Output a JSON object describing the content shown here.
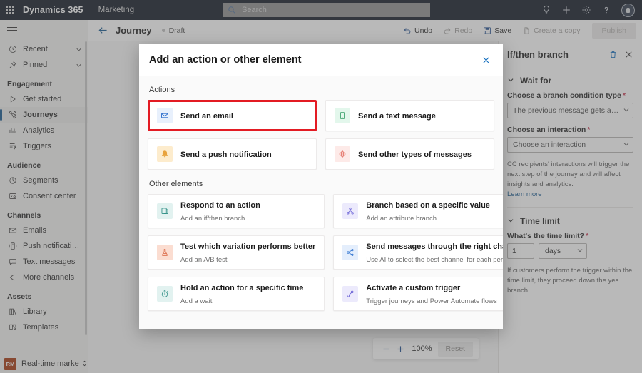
{
  "header": {
    "brand": "Dynamics 365",
    "app_name": "Marketing",
    "waffle_name": "app-launcher",
    "search": {
      "placeholder": "Search",
      "value": ""
    },
    "actions": [
      {
        "name": "lightbulb-icon",
        "label": "Tips"
      },
      {
        "name": "plus-icon",
        "label": "Quick create"
      },
      {
        "name": "gear-icon",
        "label": "Settings"
      },
      {
        "name": "question-icon",
        "label": "Help"
      }
    ],
    "avatar_label": "Account manager"
  },
  "sidebar": {
    "hamburger_label": "Show more",
    "quick": [
      {
        "label": "Recent",
        "icon": "clock-icon",
        "expandable": true
      },
      {
        "label": "Pinned",
        "icon": "pin-icon",
        "expandable": true
      }
    ],
    "groups": [
      {
        "title": "Engagement",
        "items": [
          {
            "label": "Get started",
            "icon": "play-icon",
            "selected": false
          },
          {
            "label": "Journeys",
            "icon": "journeys-icon",
            "selected": true
          },
          {
            "label": "Analytics",
            "icon": "analytics-icon",
            "selected": false
          },
          {
            "label": "Triggers",
            "icon": "triggers-icon",
            "selected": false
          }
        ]
      },
      {
        "title": "Audience",
        "items": [
          {
            "label": "Segments",
            "icon": "segments-icon",
            "selected": false
          },
          {
            "label": "Consent center",
            "icon": "consent-icon",
            "selected": false
          }
        ]
      },
      {
        "title": "Channels",
        "items": [
          {
            "label": "Emails",
            "icon": "email-icon",
            "selected": false
          },
          {
            "label": "Push notifications",
            "icon": "push-icon",
            "selected": false
          },
          {
            "label": "Text messages",
            "icon": "chat-icon",
            "selected": false
          },
          {
            "label": "More channels",
            "icon": "channels-icon",
            "selected": false
          }
        ]
      },
      {
        "title": "Assets",
        "items": [
          {
            "label": "Library",
            "icon": "library-icon",
            "selected": false
          },
          {
            "label": "Templates",
            "icon": "templates-icon",
            "selected": false
          }
        ]
      }
    ],
    "area_switcher": {
      "initials": "RM",
      "label": "Real-time marketi..."
    }
  },
  "commandbar": {
    "back_label": "Back",
    "title": "Journey",
    "status": "Draft",
    "buttons": [
      {
        "label": "Undo",
        "icon": "undo-icon",
        "disabled": false
      },
      {
        "label": "Redo",
        "icon": "redo-icon",
        "disabled": true
      },
      {
        "label": "Save",
        "icon": "save-icon",
        "disabled": false
      },
      {
        "label": "Create a copy",
        "icon": "copy-icon",
        "disabled": true
      }
    ],
    "publish_label": "Publish"
  },
  "dialog": {
    "title": "Add an action or other element",
    "close_label": "Close",
    "sections": [
      {
        "heading": "Actions",
        "cards": [
          {
            "title": "Send an email",
            "subtitle": "",
            "icon": "email-icon",
            "tile_bg": "#e8f0fc",
            "icon_color": "#2266c9",
            "highlighted": true
          },
          {
            "title": "Send a text message",
            "subtitle": "",
            "icon": "phone-icon",
            "tile_bg": "#e3f7ec",
            "icon_color": "#3aa06a",
            "highlighted": false
          },
          {
            "title": "Send a push notification",
            "subtitle": "",
            "icon": "bell-icon",
            "tile_bg": "#fdeccd",
            "icon_color": "#e8a33d",
            "highlighted": false
          },
          {
            "title": "Send other types of messages",
            "subtitle": "",
            "icon": "diamond-icon",
            "tile_bg": "#fdeae8",
            "icon_color": "#e2685c",
            "highlighted": false
          }
        ]
      },
      {
        "heading": "Other elements",
        "cards": [
          {
            "title": "Respond to an action",
            "subtitle": "Add an if/then branch",
            "icon": "branch-note-icon",
            "tile_bg": "#e2f2f0",
            "icon_color": "#2f8f85",
            "highlighted": false
          },
          {
            "title": "Branch based on a specific value",
            "subtitle": "Add an attribute branch",
            "icon": "attribute-branch-icon",
            "tile_bg": "#eceafc",
            "icon_color": "#6b63d6",
            "highlighted": false
          },
          {
            "title": "Test which variation performs better",
            "subtitle": "Add an A/B test",
            "icon": "flask-icon",
            "tile_bg": "#fbddd1",
            "icon_color": "#d9633f",
            "highlighted": false
          },
          {
            "title": "Send messages through the right channel",
            "subtitle": "Use AI to select the best channel for each person",
            "icon": "channel-ai-icon",
            "tile_bg": "#e4eefc",
            "icon_color": "#2a6fce",
            "highlighted": false
          },
          {
            "title": "Hold an action for a specific time",
            "subtitle": "Add a wait",
            "icon": "stopwatch-icon",
            "tile_bg": "#e2f2f0",
            "icon_color": "#2f8f85",
            "highlighted": false
          },
          {
            "title": "Activate a custom trigger",
            "subtitle": "Trigger journeys and Power Automate flows",
            "icon": "custom-trigger-icon",
            "tile_bg": "#eceafc",
            "icon_color": "#6b63d6",
            "highlighted": false
          }
        ]
      }
    ]
  },
  "rightpanel": {
    "title": "If/then branch",
    "delete_label": "Delete",
    "close_label": "Close",
    "sections": [
      {
        "name": "wait-for",
        "heading": "Wait for",
        "fields": [
          {
            "label": "Choose a branch condition type",
            "required": true,
            "value": "The previous message gets an interacti..."
          },
          {
            "label": "Choose an interaction",
            "required": true,
            "value": "Choose an interaction"
          }
        ],
        "help": "CC recipients' interactions will trigger the next step of the journey and will affect insights and analytics.",
        "link": "Learn more"
      },
      {
        "name": "time-limit",
        "heading": "Time limit",
        "fields": [
          {
            "label": "What's the time limit?",
            "required": true,
            "number_value": "1",
            "unit_value": "days"
          }
        ],
        "help": "If customers perform the trigger within the time limit, they proceed down the yes branch."
      }
    ]
  },
  "zoombar": {
    "zoom_out_label": "Zoom out",
    "zoom_in_label": "Zoom in",
    "value": "100%",
    "reset_label": "Reset"
  },
  "colors": {
    "topbar_bg": "#0b1320",
    "accent": "#0f6cbd",
    "highlight_red": "#e31b23",
    "status_dot": "#bdbdbd",
    "area_badge": "#a4330a"
  }
}
